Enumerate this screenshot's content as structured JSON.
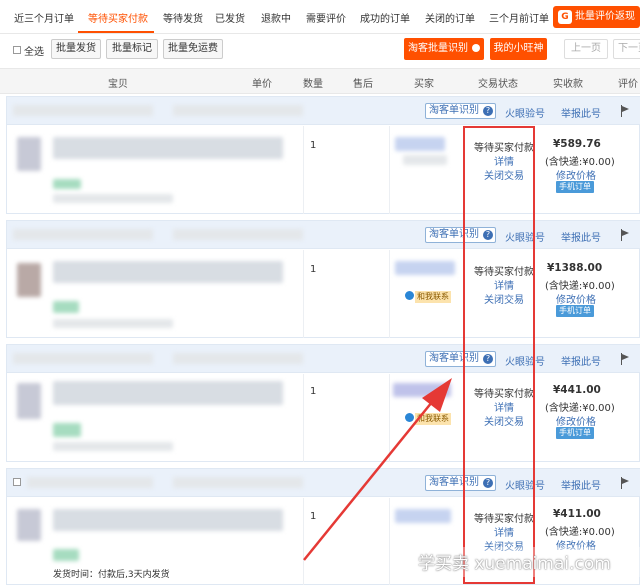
{
  "tabs": [
    {
      "label": "近三个月订单",
      "active": false
    },
    {
      "label": "等待买家付款",
      "active": true
    },
    {
      "label": "等待发货",
      "active": false
    },
    {
      "label": "已发货",
      "active": false
    },
    {
      "label": "退款中",
      "active": false
    },
    {
      "label": "需要评价",
      "active": false
    },
    {
      "label": "成功的订单",
      "active": false
    },
    {
      "label": "关闭的订单",
      "active": false
    },
    {
      "label": "三个月前订单",
      "active": false
    }
  ],
  "rate_button": {
    "icon": "gift-icon",
    "icon_text": "G",
    "label": "批量评价返现"
  },
  "toolbar": {
    "select_all": "全选",
    "batch_ship": "批量发货",
    "batch_mark": "批量标记",
    "batch_free_ship": "批量免运费",
    "batch_identify": "淘客批量识别",
    "my_wangwang": "我的小旺神",
    "prev_page": "上一页",
    "next_page": "下一页"
  },
  "columns": [
    "宝贝",
    "单价",
    "数量",
    "售后",
    "买家",
    "交易状态",
    "实收款",
    "评价"
  ],
  "order_header": {
    "identify": "淘客单识别",
    "help": "?",
    "verify": "火眼验号",
    "report": "举报此号"
  },
  "orders": [
    {
      "qty": "1",
      "status": "等待买家付款",
      "detail": "详情",
      "close": "关闭交易",
      "price": "¥589.76",
      "shipping": "(含快递:¥0.00)",
      "modify": "修改价格",
      "mobile": "手机订单",
      "contact": "",
      "ship_time": ""
    },
    {
      "qty": "1",
      "status": "等待买家付款",
      "detail": "详情",
      "close": "关闭交易",
      "price": "¥1388.00",
      "shipping": "(含快递:¥0.00)",
      "modify": "修改价格",
      "mobile": "手机订单",
      "contact": "和我联系",
      "ship_time": ""
    },
    {
      "qty": "1",
      "status": "等待买家付款",
      "detail": "详情",
      "close": "关闭交易",
      "price": "¥441.00",
      "shipping": "(含快递:¥0.00)",
      "modify": "修改价格",
      "mobile": "手机订单",
      "contact": "和我联系",
      "ship_time": ""
    },
    {
      "qty": "1",
      "status": "等待买家付款",
      "detail": "详情",
      "close": "关闭交易",
      "price": "¥411.00",
      "shipping": "(含快递:¥0.00)",
      "modify": "修改价格",
      "mobile": "",
      "contact": "",
      "ship_time": "发货时间：付款后,3天内发货"
    }
  ],
  "watermark": "学买卖 xuemaimai.com",
  "colors": {
    "accent": "#ff5000",
    "link": "#3d6fb4",
    "highlight": "#e53935",
    "header_bg": "#eaf1fa"
  }
}
